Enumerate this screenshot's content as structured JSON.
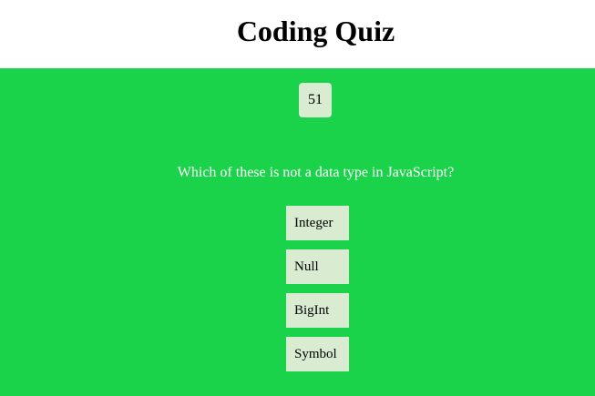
{
  "header": {
    "title": "Coding Quiz"
  },
  "quiz": {
    "timer": "51",
    "question": "Which of these is not a data type in JavaScript?",
    "answers": [
      "Integer",
      "Null",
      "BigInt",
      "Symbol"
    ]
  },
  "colors": {
    "background": "#1bd34a",
    "button": "#d9ecd2"
  }
}
